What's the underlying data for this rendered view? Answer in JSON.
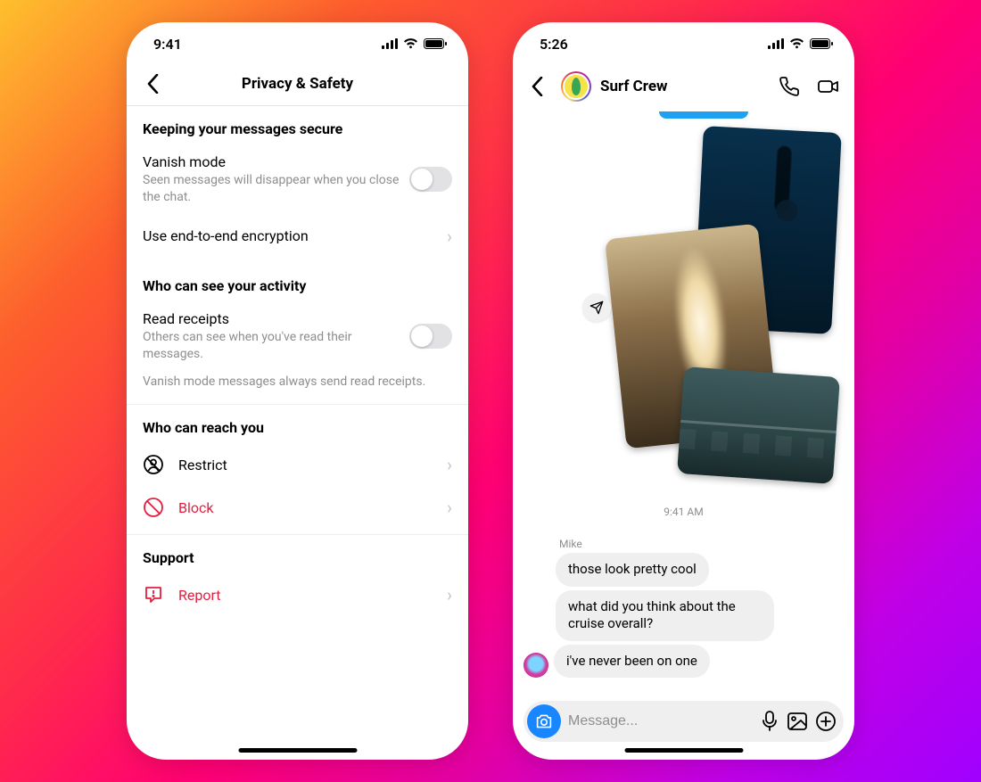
{
  "left": {
    "status_time": "9:41",
    "title": "Privacy & Safety",
    "sec1": "Keeping your messages secure",
    "vanish_title": "Vanish mode",
    "vanish_sub": "Seen messages will disappear when you close the chat.",
    "e2ee": "Use end-to-end encryption",
    "sec2": "Who can see your activity",
    "rr_title": "Read receipts",
    "rr_sub": "Others can see when you've read their messages.",
    "rr_note": "Vanish mode messages always send read receipts.",
    "sec3": "Who can reach you",
    "restrict": "Restrict",
    "block": "Block",
    "sec4": "Support",
    "report": "Report"
  },
  "right": {
    "status_time": "5:26",
    "chat_title": "Surf Crew",
    "timestamp": "9:41 AM",
    "sender": "Mike",
    "msg1": "those look pretty cool",
    "msg2": "what did you think about the cruise overall?",
    "msg3": "i've never been on one",
    "placeholder": "Message..."
  }
}
